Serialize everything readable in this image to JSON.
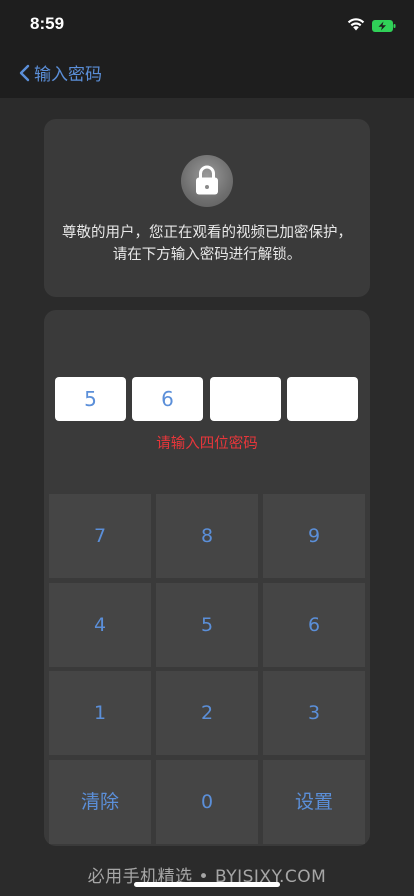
{
  "status": {
    "time": "8:59"
  },
  "nav": {
    "back_label": "输入密码"
  },
  "lock_card": {
    "message": "尊敬的用户，您正在观看的视频已加密保护，请在下方输入密码进行解锁。"
  },
  "pin": {
    "digits": [
      "5",
      "6",
      "",
      ""
    ],
    "hint": "请输入四位密码"
  },
  "keypad": {
    "keys": [
      "7",
      "8",
      "9",
      "4",
      "5",
      "6",
      "1",
      "2",
      "3",
      "清除",
      "0",
      "设置"
    ]
  },
  "watermark": "必用手机精选 • BYJSJXY.COM",
  "colors": {
    "accent": "#5b8fd9",
    "error": "#e8363a",
    "background": "#2b2b2b",
    "card": "#3a3a3a",
    "key": "#454545",
    "battery": "#30d158"
  },
  "icons": [
    "wifi-icon",
    "battery-charging-icon",
    "chevron-left-icon",
    "lock-icon"
  ]
}
